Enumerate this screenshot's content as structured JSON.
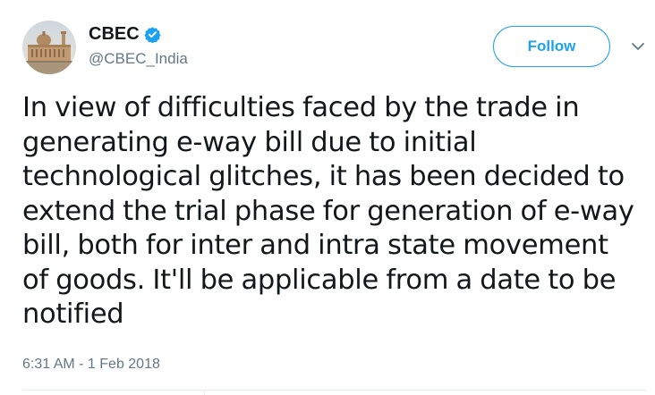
{
  "author": {
    "display_name": "CBEC",
    "handle": "@CBEC_India",
    "verified": true,
    "avatar_icon": "building-avatar"
  },
  "actions": {
    "follow_label": "Follow",
    "menu_icon": "chevron-down-icon"
  },
  "tweet": {
    "lines": [
      "In view of difficulties faced by the trade in",
      "generating e-way bill due to initial",
      "technological glitches, it has been decided to",
      "extend the trial phase for generation of e-way",
      "bill, both for inter and intra state movement",
      "of goods. It'll be applicable from a date to be",
      "notified"
    ],
    "timestamp": "6:31 AM - 1 Feb 2018"
  },
  "colors": {
    "accent": "#1da1f2",
    "text": "#14171a",
    "muted": "#657786",
    "divider": "#e6ecf0"
  }
}
